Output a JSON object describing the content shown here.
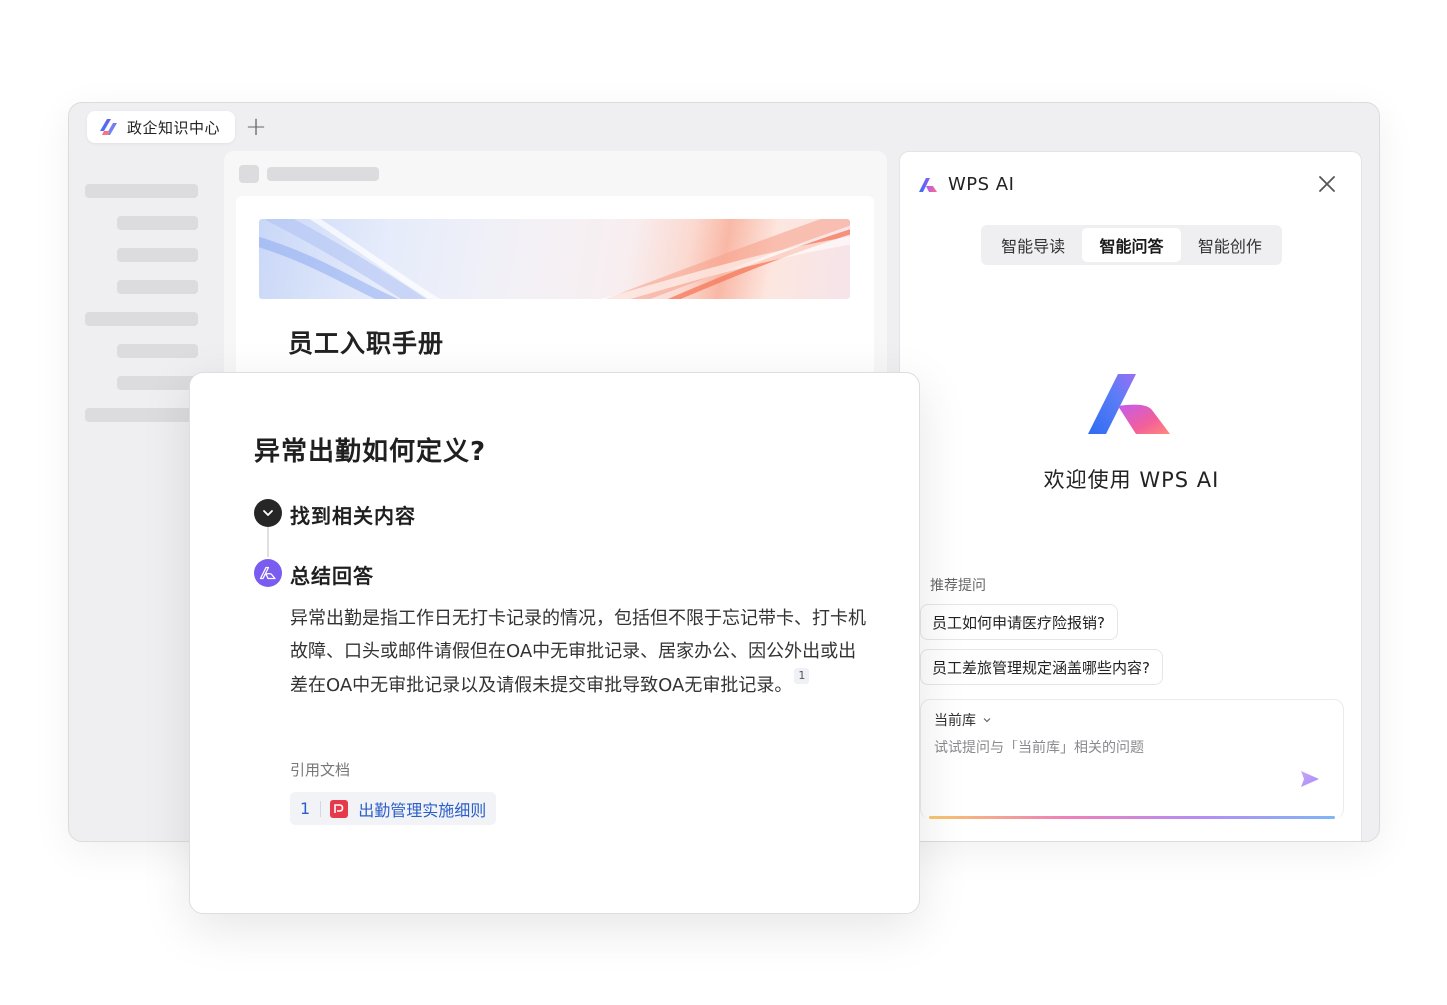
{
  "tab": {
    "label": "政企知识中心",
    "new_tab": "+"
  },
  "document": {
    "title": "员工入职手册"
  },
  "ai_panel": {
    "title": "WPS AI",
    "tabs": [
      "智能导读",
      "智能问答",
      "智能创作"
    ],
    "active_tab": "智能问答",
    "welcome": "欢迎使用 WPS AI",
    "suggest_label": "推荐提问",
    "suggestions": [
      "员工如何申请医疗险报销?",
      "员工差旅管理规定涵盖哪些内容?"
    ],
    "scope": "当前库",
    "input_placeholder": "试试提问与「当前库」相关的问题"
  },
  "answer_card": {
    "question": "异常出勤如何定义?",
    "step1": "找到相关内容",
    "step2": "总结回答",
    "answer": "异常出勤是指工作日无打卡记录的情况，包括但不限于忘记带卡、打卡机故障、口头或邮件请假但在OA中无审批记录、居家办公、因公外出或出差在OA中无审批记录以及请假未提交审批导致OA无审批记录。",
    "citation_marker": "1",
    "ref_label": "引用文档",
    "ref_number": "1",
    "ref_title": "出勤管理实施细则"
  }
}
